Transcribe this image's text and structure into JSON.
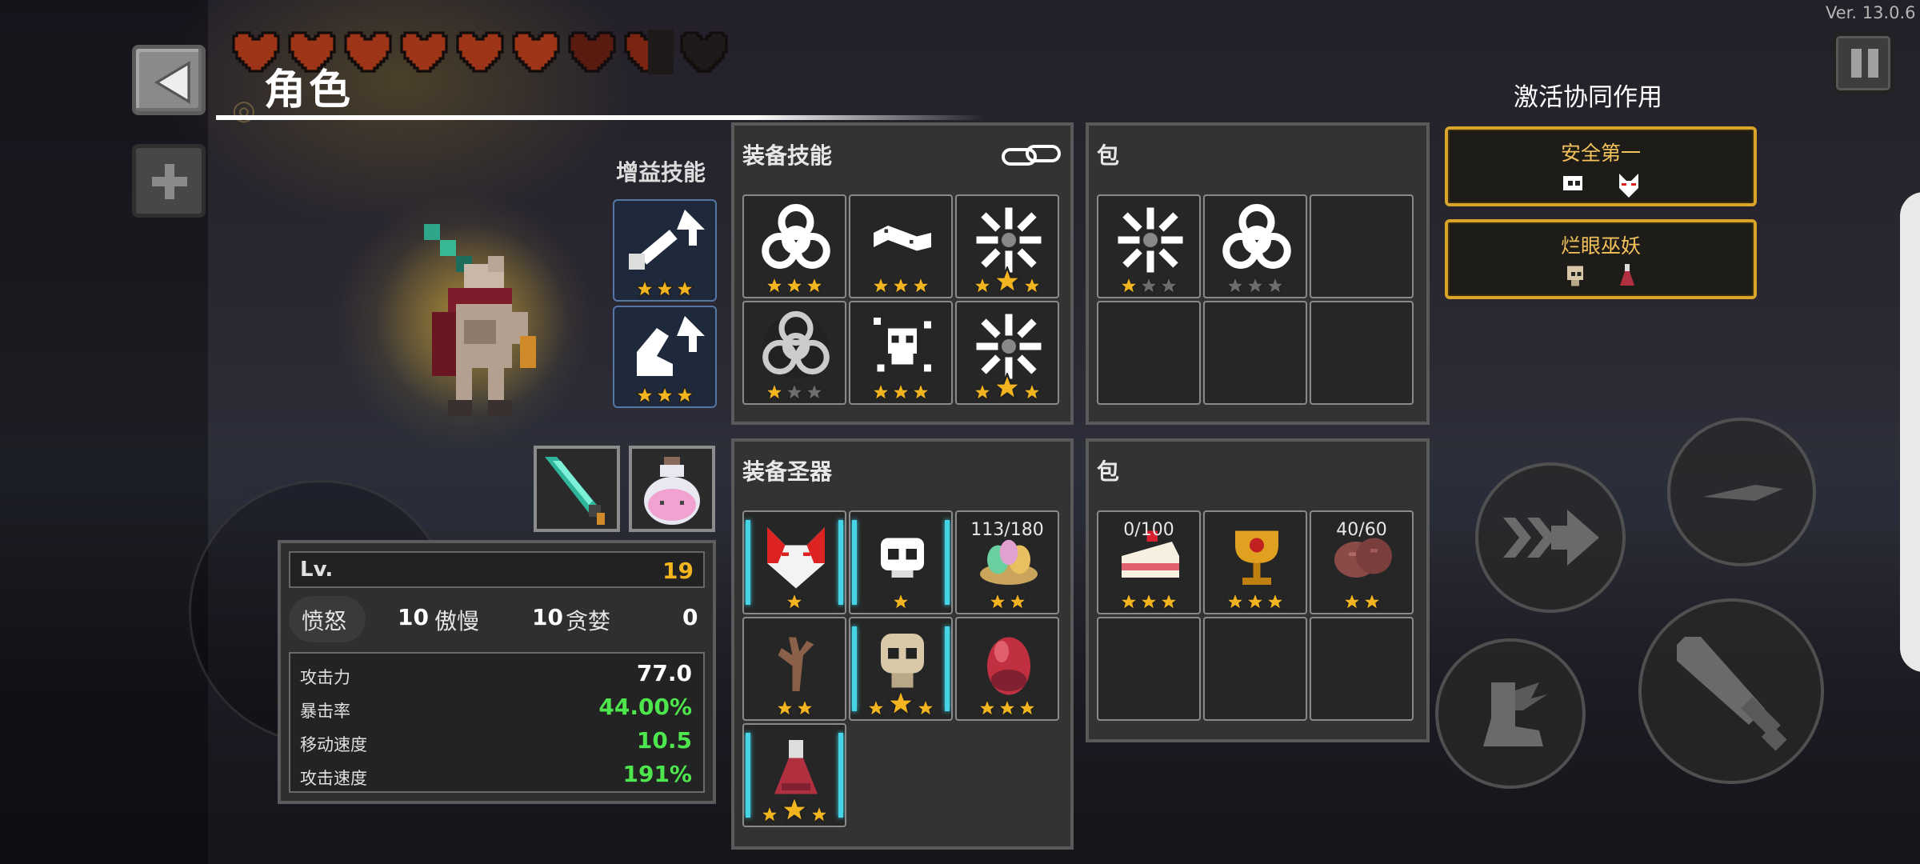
{
  "version": "Ver. 13.0.6",
  "title": "角色",
  "hearts": [
    "full",
    "full",
    "full",
    "full",
    "full",
    "full",
    "dark",
    "half",
    "empty"
  ],
  "buff_section": {
    "label": "增益技能",
    "slots": [
      {
        "icon": "sword-up-icon",
        "stars": 3
      },
      {
        "icon": "boot-up-icon",
        "stars": 3
      }
    ]
  },
  "equipped": {
    "weapon_icon": "green-blade-icon",
    "potion_icon": "pink-potion-icon"
  },
  "stats": {
    "level_label": "Lv.",
    "level": "19",
    "sins": [
      {
        "name": "愤怒",
        "value": "10"
      },
      {
        "name": "傲慢",
        "value": "10"
      },
      {
        "name": "贪婪",
        "value": "0"
      }
    ],
    "attributes": [
      {
        "name": "攻击力",
        "value": "77.0",
        "color": "#ffffff"
      },
      {
        "name": "暴击率",
        "value": "44.00%",
        "color": "#4de64d"
      },
      {
        "name": "移动速度",
        "value": "10.5",
        "color": "#4de64d"
      },
      {
        "name": "攻击速度",
        "value": "191%",
        "color": "#4de64d"
      }
    ]
  },
  "skills_panel": {
    "title": "装备技能",
    "link_icon": "chain-link-icon",
    "slots": [
      {
        "icon": "biohazard-icon",
        "stars": [
          1,
          1,
          1
        ]
      },
      {
        "icon": "bone-club-icon",
        "stars": [
          1,
          1,
          1
        ]
      },
      {
        "icon": "spark-burst-icon",
        "stars": [
          1,
          2,
          1
        ]
      },
      {
        "icon": "biohazard-dark-icon",
        "stars": [
          1,
          0,
          0
        ]
      },
      {
        "icon": "skull-splash-icon",
        "stars": [
          1,
          1,
          1
        ]
      },
      {
        "icon": "spark-burst-icon",
        "stars": [
          1,
          2,
          1
        ]
      }
    ]
  },
  "skill_bag": {
    "title": "包",
    "slots": [
      {
        "icon": "spark-burst-icon",
        "stars": [
          1,
          0,
          0
        ]
      },
      {
        "icon": "biohazard-icon",
        "stars": [
          0,
          0,
          0
        ]
      },
      null,
      null,
      null,
      null
    ]
  },
  "relics_panel": {
    "title": "装备圣器",
    "slots": [
      {
        "icon": "fox-mask-icon",
        "stars": [
          1
        ],
        "cyan": true
      },
      {
        "icon": "white-skull-icon",
        "stars": [
          1
        ],
        "cyan": true
      },
      {
        "icon": "egg-nest-icon",
        "stars": [
          1,
          1
        ],
        "count": "113/180"
      },
      {
        "icon": "twig-icon",
        "stars": [
          1,
          1
        ]
      },
      {
        "icon": "tan-skull-icon",
        "stars": [
          1,
          2,
          1
        ],
        "cyan": true
      },
      {
        "icon": "red-egg-icon",
        "stars": [
          1,
          1,
          1
        ]
      },
      {
        "icon": "red-potion-icon",
        "stars": [
          1,
          2,
          1
        ],
        "cyan": true
      }
    ]
  },
  "relic_bag": {
    "title": "包",
    "slots": [
      {
        "icon": "cake-icon",
        "stars": [
          1,
          1,
          1
        ],
        "count": "0/100"
      },
      {
        "icon": "gold-chalice-icon",
        "stars": [
          1,
          1,
          1
        ]
      },
      {
        "icon": "meat-icon",
        "stars": [
          1,
          1
        ],
        "count": "40/60"
      },
      null,
      null,
      null
    ]
  },
  "synergy": {
    "title": "激活协同作用",
    "items": [
      {
        "name": "安全第一",
        "icons": [
          "white-skull-icon",
          "fox-mask-icon"
        ]
      },
      {
        "name": "烂眼巫妖",
        "icons": [
          "tan-skull-icon",
          "red-potion-icon"
        ]
      }
    ]
  },
  "colors": {
    "gold": "#f2b51f",
    "green": "#4de64d",
    "cyan": "#47d3e6",
    "synergy_border": "#d9a42a"
  }
}
